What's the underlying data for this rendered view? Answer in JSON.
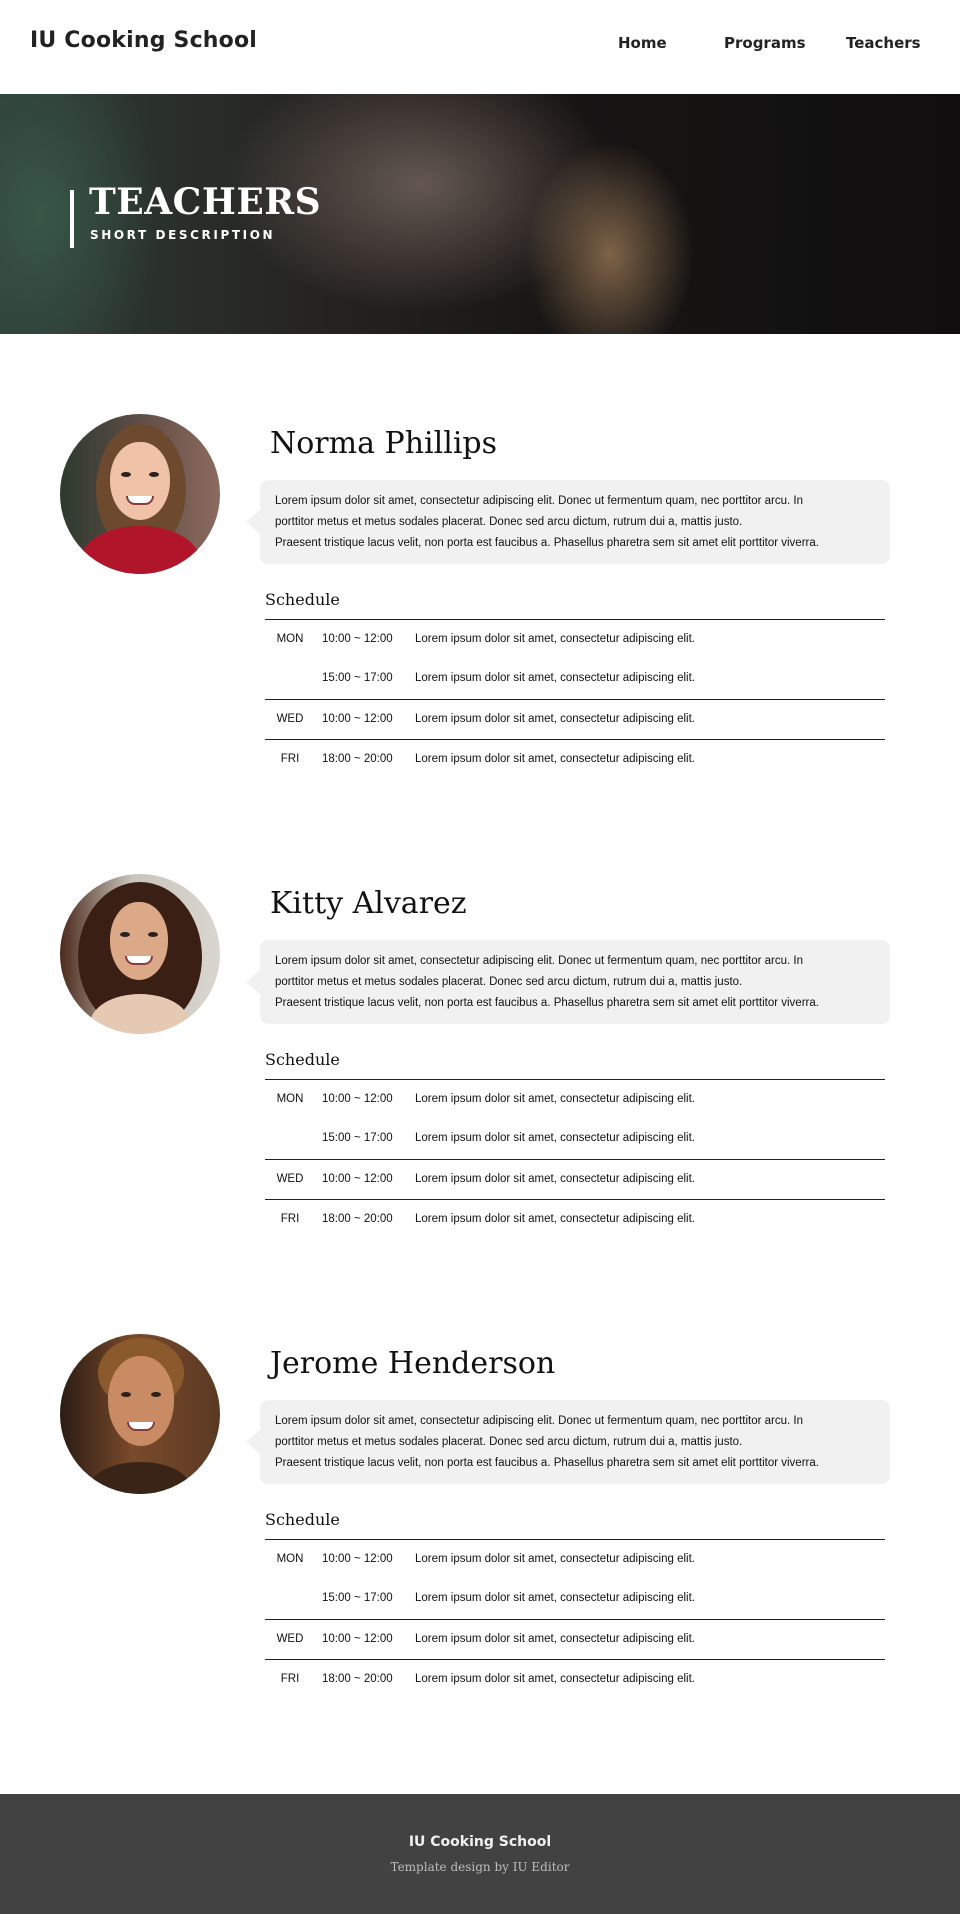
{
  "header": {
    "brand": "IU Cooking School",
    "nav": [
      "Home",
      "Programs",
      "Teachers"
    ]
  },
  "hero": {
    "title": "TEACHERS",
    "subtitle": "SHORT DESCRIPTION"
  },
  "teachers": [
    {
      "name": "Norma Phillips",
      "bio": [
        "Lorem ipsum dolor sit amet, consectetur adipiscing elit. Donec ut fermentum quam, nec porttitor arcu. In",
        "porttitor metus et metus sodales placerat. Donec sed arcu dictum, rutrum dui a, mattis justo.",
        "Praesent tristique lacus velit, non porta est faucibus a. Phasellus pharetra sem sit amet elit porttitor viverra."
      ],
      "schedule_title": "Schedule",
      "schedule": [
        {
          "day": "MON",
          "time": "10:00 ~ 12:00",
          "desc": "Lorem ipsum dolor sit amet, consectetur adipiscing elit."
        },
        {
          "day": "",
          "time": "15:00 ~ 17:00",
          "desc": "Lorem ipsum dolor sit amet, consectetur adipiscing elit."
        },
        {
          "day": "WED",
          "time": "10:00 ~ 12:00",
          "desc": "Lorem ipsum dolor sit amet, consectetur adipiscing elit."
        },
        {
          "day": "FRI",
          "time": "18:00 ~ 20:00",
          "desc": "Lorem ipsum dolor sit amet, consectetur adipiscing elit."
        }
      ]
    },
    {
      "name": "Kitty Alvarez",
      "bio": [
        "Lorem ipsum dolor sit amet, consectetur adipiscing elit. Donec ut fermentum quam, nec porttitor arcu. In",
        "porttitor metus et metus sodales placerat. Donec sed arcu dictum, rutrum dui a, mattis justo.",
        "Praesent tristique lacus velit, non porta est faucibus a. Phasellus pharetra sem sit amet elit porttitor viverra."
      ],
      "schedule_title": "Schedule",
      "schedule": [
        {
          "day": "MON",
          "time": "10:00 ~ 12:00",
          "desc": "Lorem ipsum dolor sit amet, consectetur adipiscing elit."
        },
        {
          "day": "",
          "time": "15:00 ~ 17:00",
          "desc": "Lorem ipsum dolor sit amet, consectetur adipiscing elit."
        },
        {
          "day": "WED",
          "time": "10:00 ~ 12:00",
          "desc": "Lorem ipsum dolor sit amet, consectetur adipiscing elit."
        },
        {
          "day": "FRI",
          "time": "18:00 ~ 20:00",
          "desc": "Lorem ipsum dolor sit amet, consectetur adipiscing elit."
        }
      ]
    },
    {
      "name": "Jerome Henderson",
      "bio": [
        "Lorem ipsum dolor sit amet, consectetur adipiscing elit. Donec ut fermentum quam, nec porttitor arcu. In",
        "porttitor metus et metus sodales placerat. Donec sed arcu dictum, rutrum dui a, mattis justo.",
        "Praesent tristique lacus velit, non porta est faucibus a. Phasellus pharetra sem sit amet elit porttitor viverra."
      ],
      "schedule_title": "Schedule",
      "schedule": [
        {
          "day": "MON",
          "time": "10:00 ~ 12:00",
          "desc": "Lorem ipsum dolor sit amet, consectetur adipiscing elit."
        },
        {
          "day": "",
          "time": "15:00 ~ 17:00",
          "desc": "Lorem ipsum dolor sit amet, consectetur adipiscing elit."
        },
        {
          "day": "WED",
          "time": "10:00 ~ 12:00",
          "desc": "Lorem ipsum dolor sit amet, consectetur adipiscing elit."
        },
        {
          "day": "FRI",
          "time": "18:00 ~ 20:00",
          "desc": "Lorem ipsum dolor sit amet, consectetur adipiscing elit."
        }
      ]
    }
  ],
  "footer": {
    "brand": "IU Cooking School",
    "credit": "Template design by IU Editor"
  }
}
